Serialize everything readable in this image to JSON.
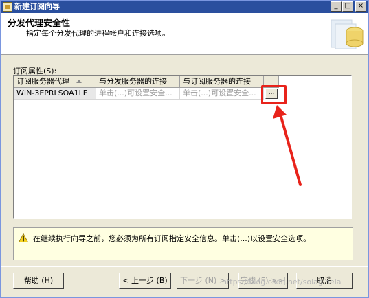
{
  "window": {
    "title": "新建订阅向导",
    "min_glyph": "_",
    "max_glyph": "□",
    "close_glyph": "×"
  },
  "header": {
    "title": "分发代理安全性",
    "description": "指定每个分发代理的进程帐户和连接选项。"
  },
  "group_label": "订阅属性(S):",
  "grid": {
    "columns": [
      "订阅服务器代理",
      "与分发服务器的连接",
      "与订阅服务器的连接"
    ],
    "rows": [
      {
        "agent": "WIN-3EPRLSOA1LE",
        "distributor_connection": "单击(...)可设置安全...",
        "subscriber_connection": "单击(...)可设置安全...",
        "button": "..."
      }
    ]
  },
  "warning": {
    "text": "在继续执行向导之前，您必须为所有订阅指定安全信息。单击(...)以设置安全选项。"
  },
  "buttons": {
    "help": "帮助 (H)",
    "back": "< 上一步 (B)",
    "next": "下一步 (N) >",
    "finish": "完成 (F) >>|",
    "cancel": "取消"
  },
  "watermark": "https://blog.csdn.net/solaginela",
  "colors": {
    "titlebar": "#2a4f9e",
    "highlight": "#e8231b",
    "warning_bg": "#ffffe1"
  }
}
